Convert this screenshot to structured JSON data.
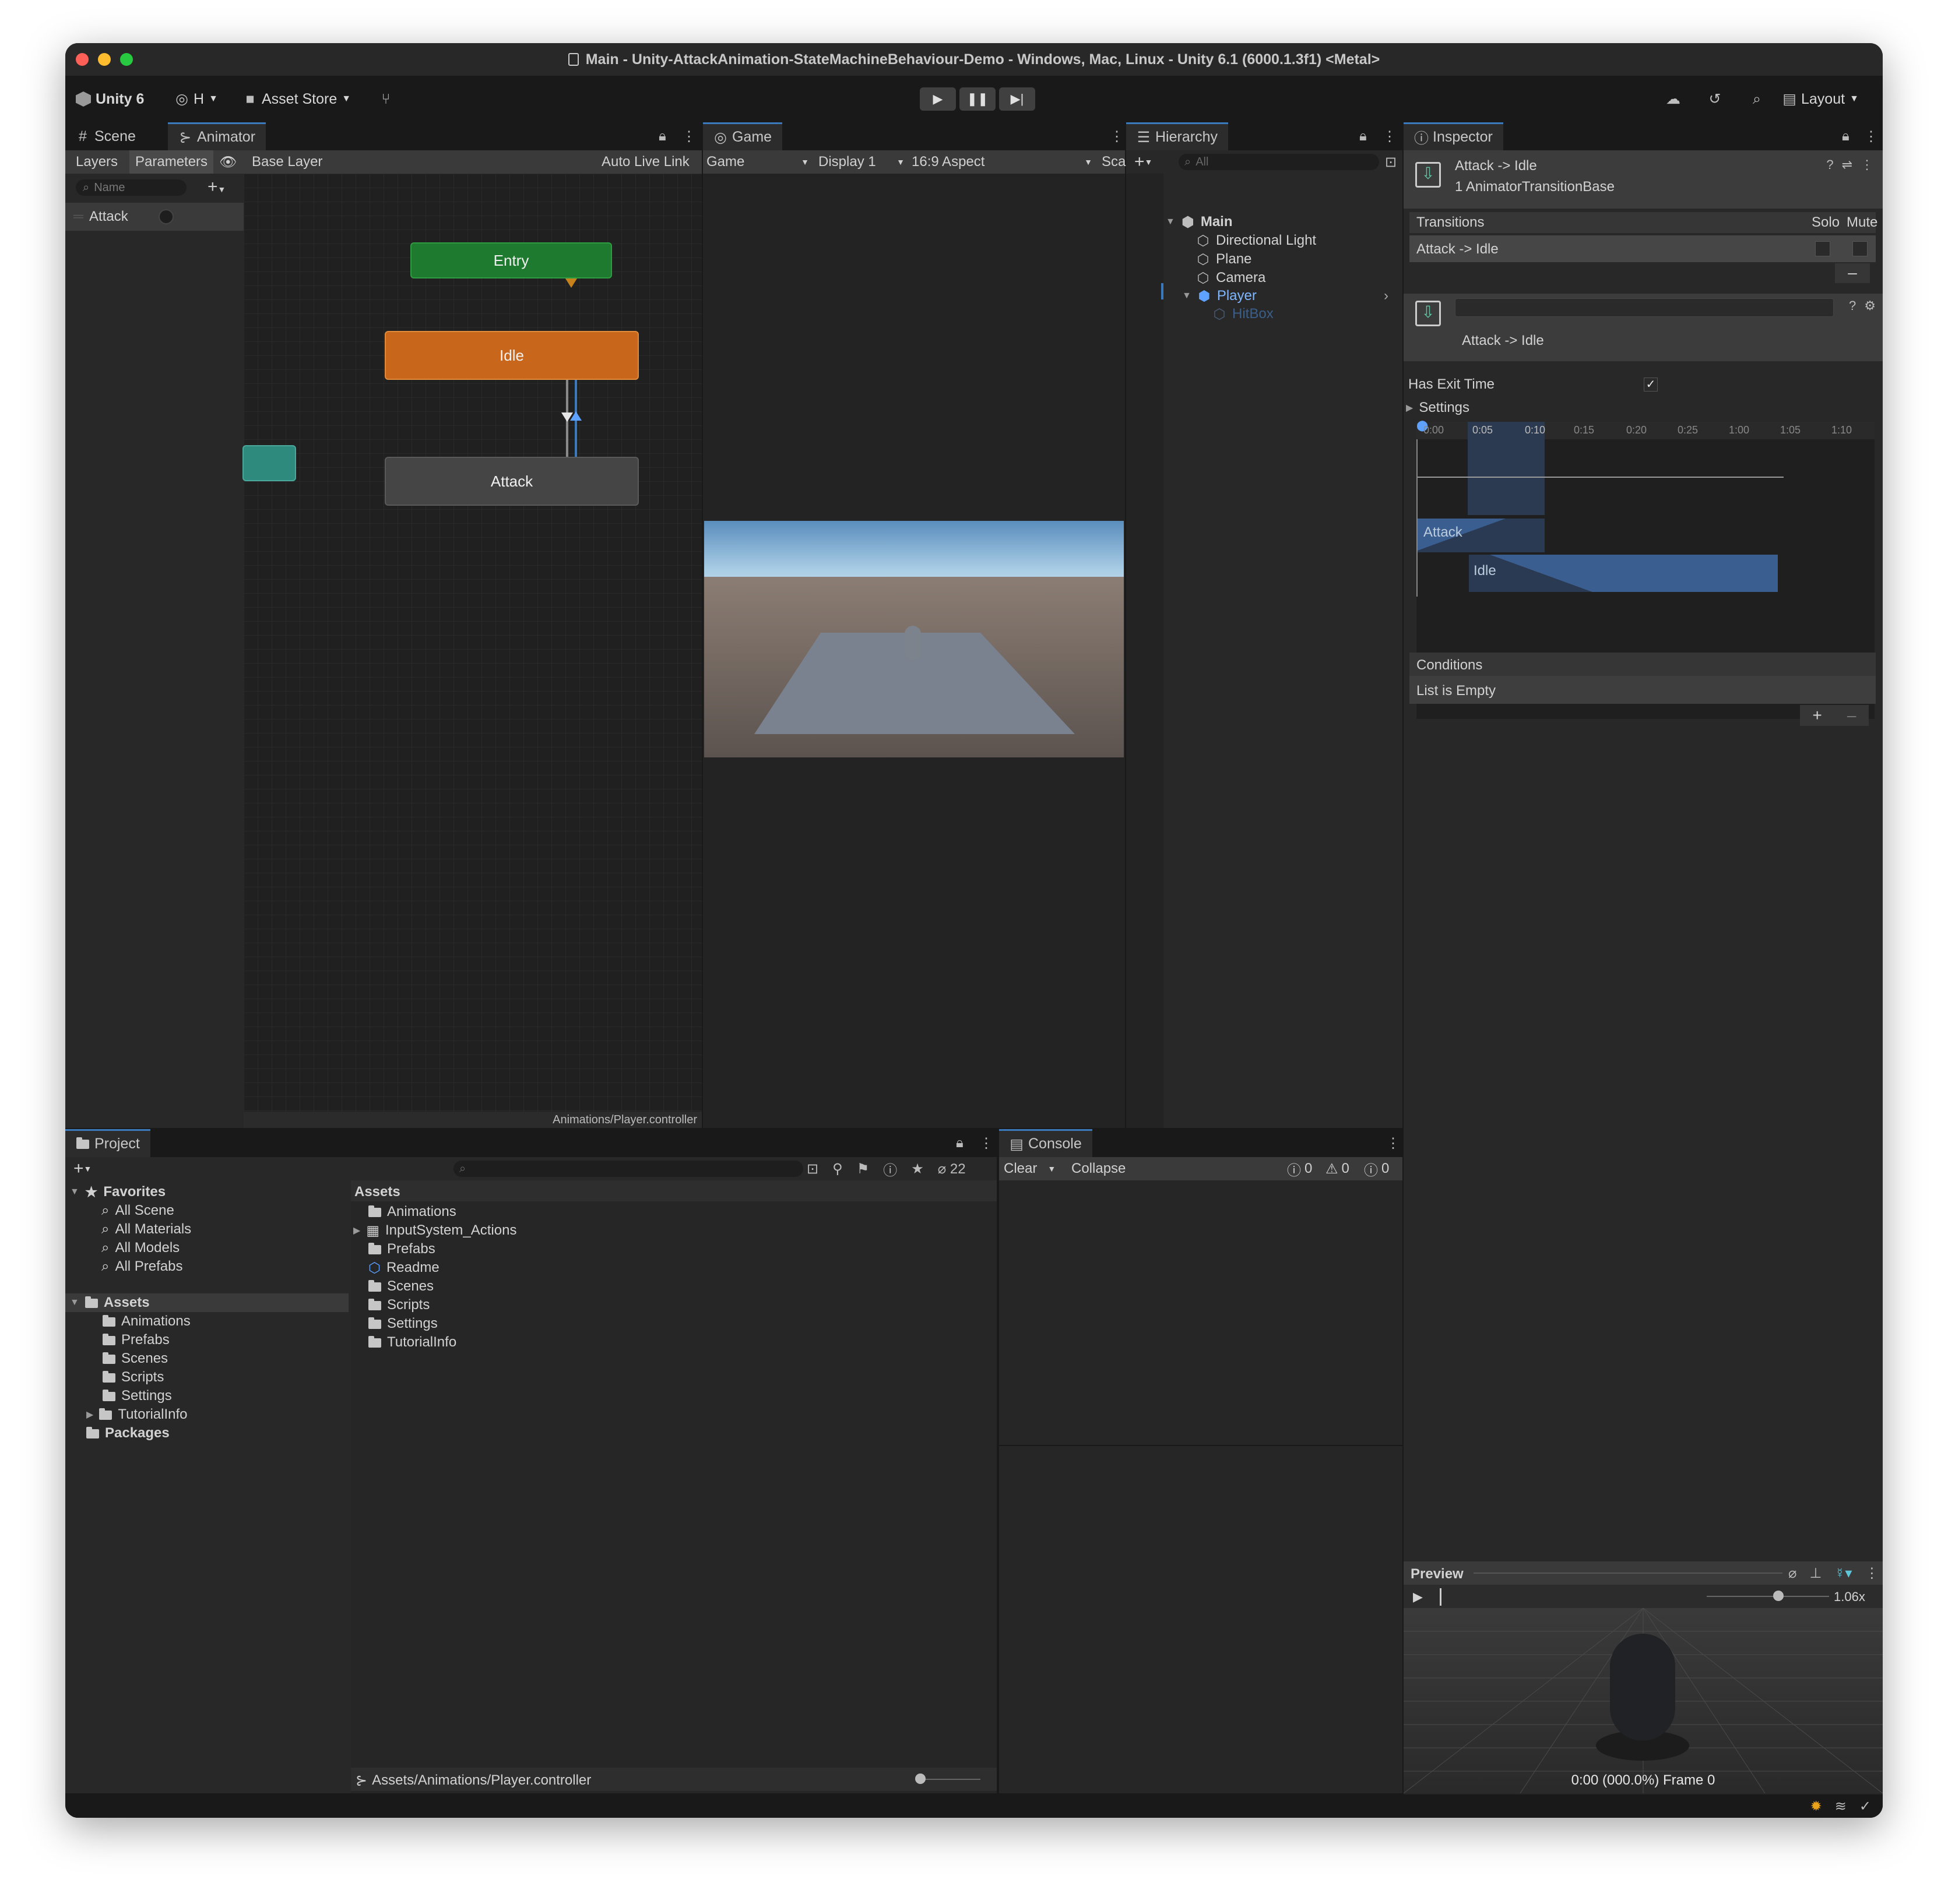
{
  "window": {
    "title": "Main - Unity-AttackAnimation-StateMachineBehaviour-Demo - Windows, Mac, Linux - Unity 6.1 (6000.1.3f1) <Metal>"
  },
  "toolbar": {
    "unity_label": "Unity 6",
    "account_label": "H",
    "asset_store_label": "Asset Store",
    "layout_label": "Layout"
  },
  "scene_tabs": {
    "scene": "Scene",
    "animator": "Animator"
  },
  "animator": {
    "layers_tab": "Layers",
    "parameters_tab": "Parameters",
    "base_layer": "Base Layer",
    "auto_live_link": "Auto Live Link",
    "search_placeholder": "Name",
    "parameters": [
      {
        "name": "Attack"
      }
    ],
    "states": {
      "entry": "Entry",
      "idle": "Idle",
      "attack": "Attack"
    },
    "path": "Animations/Player.controller"
  },
  "game": {
    "tab": "Game",
    "mode": "Game",
    "display": "Display 1",
    "aspect": "16:9 Aspect",
    "scale": "Sca"
  },
  "hierarchy": {
    "tab": "Hierarchy",
    "search_placeholder": "All",
    "items": [
      {
        "label": "Main"
      },
      {
        "label": "Directional Light"
      },
      {
        "label": "Plane"
      },
      {
        "label": "Camera"
      },
      {
        "label": "Player"
      },
      {
        "label": "HitBox"
      }
    ]
  },
  "inspector": {
    "tab": "Inspector",
    "title": "Attack -> Idle",
    "subtitle": "1 AnimatorTransitionBase",
    "transitions_header": "Transitions",
    "solo_label": "Solo",
    "mute_label": "Mute",
    "transition_row": "Attack -> Idle",
    "detail_name": "Attack -> Idle",
    "has_exit_time": "Has Exit Time",
    "has_exit_time_checked": true,
    "settings": "Settings",
    "timeline_ticks": [
      "0:00",
      "0:05",
      "0:10",
      "0:15",
      "0:20",
      "0:25",
      "1:00",
      "1:05",
      "1:10"
    ],
    "attack_clip": "Attack",
    "idle_clip": "Idle",
    "conditions_header": "Conditions",
    "conditions_empty": "List is Empty",
    "preview_label": "Preview",
    "preview_speed": "1.06x",
    "preview_time": "0:00 (000.0%) Frame 0"
  },
  "project": {
    "tab": "Project",
    "hidden_count": "22",
    "favorites_label": "Favorites",
    "favorites": [
      {
        "label": "All Scene"
      },
      {
        "label": "All Materials"
      },
      {
        "label": "All Models"
      },
      {
        "label": "All Prefabs"
      }
    ],
    "assets_label": "Assets",
    "asset_folders": [
      {
        "label": "Animations"
      },
      {
        "label": "Prefabs"
      },
      {
        "label": "Scenes"
      },
      {
        "label": "Scripts"
      },
      {
        "label": "Settings"
      },
      {
        "label": "TutorialInfo"
      }
    ],
    "packages_label": "Packages",
    "content_header": "Assets",
    "content": [
      {
        "label": "Animations"
      },
      {
        "label": "InputSystem_Actions"
      },
      {
        "label": "Prefabs"
      },
      {
        "label": "Readme"
      },
      {
        "label": "Scenes"
      },
      {
        "label": "Scripts"
      },
      {
        "label": "Settings"
      },
      {
        "label": "TutorialInfo"
      }
    ],
    "status_path": "Assets/Animations/Player.controller"
  },
  "console": {
    "tab": "Console",
    "clear": "Clear",
    "collapse": "Collapse",
    "info_count": "0",
    "warn_count": "0",
    "error_count": "0"
  },
  "colors": {
    "entry": "#1e7a2e",
    "idle": "#c8671c",
    "attack": "#4a4a4a",
    "accent": "#3a79bb",
    "highlight": "#7fb7ff"
  }
}
